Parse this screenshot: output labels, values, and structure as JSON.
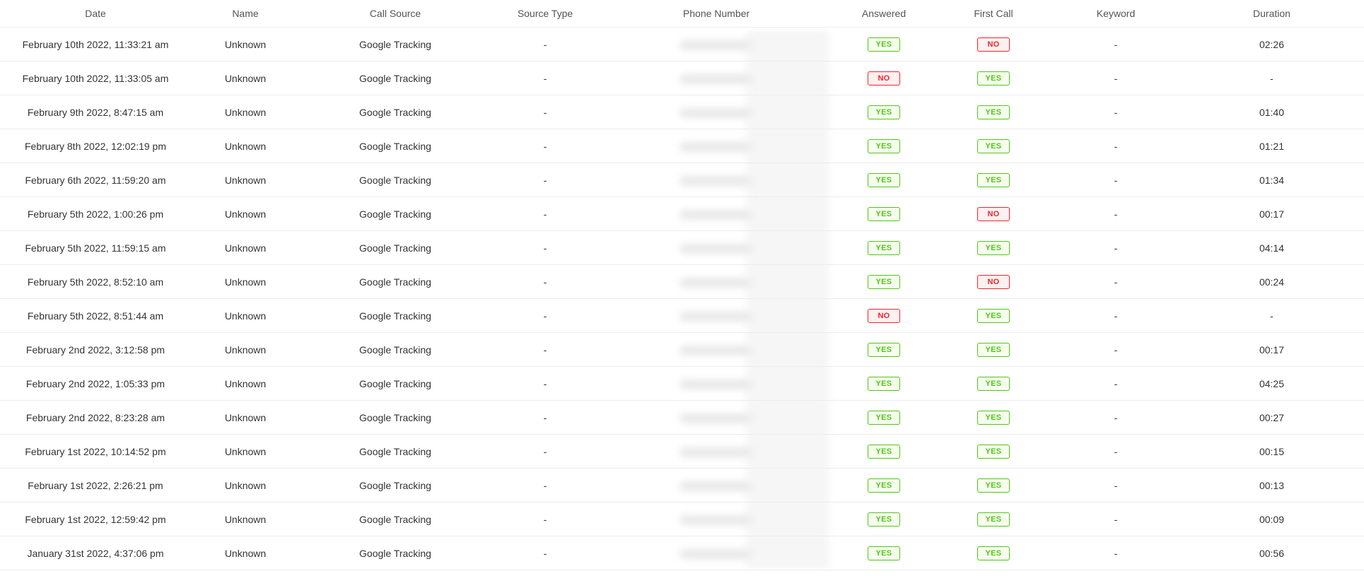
{
  "columns": {
    "date": "Date",
    "name": "Name",
    "call_source": "Call Source",
    "source_type": "Source Type",
    "phone_number": "Phone Number",
    "answered": "Answered",
    "first_call": "First Call",
    "keyword": "Keyword",
    "duration": "Duration"
  },
  "badge_colors": {
    "yes": "#52c41a",
    "no": "#f5222d"
  },
  "rows": [
    {
      "date": "February 10th 2022, 11:33:21 am",
      "name": "Unknown",
      "call_source": "Google Tracking",
      "source_type": "-",
      "answered": "YES",
      "first_call": "NO",
      "keyword": "-",
      "duration": "02:26"
    },
    {
      "date": "February 10th 2022, 11:33:05 am",
      "name": "Unknown",
      "call_source": "Google Tracking",
      "source_type": "-",
      "answered": "NO",
      "first_call": "YES",
      "keyword": "-",
      "duration": "-"
    },
    {
      "date": "February 9th 2022, 8:47:15 am",
      "name": "Unknown",
      "call_source": "Google Tracking",
      "source_type": "-",
      "answered": "YES",
      "first_call": "YES",
      "keyword": "-",
      "duration": "01:40"
    },
    {
      "date": "February 8th 2022, 12:02:19 pm",
      "name": "Unknown",
      "call_source": "Google Tracking",
      "source_type": "-",
      "answered": "YES",
      "first_call": "YES",
      "keyword": "-",
      "duration": "01:21"
    },
    {
      "date": "February 6th 2022, 11:59:20 am",
      "name": "Unknown",
      "call_source": "Google Tracking",
      "source_type": "-",
      "answered": "YES",
      "first_call": "YES",
      "keyword": "-",
      "duration": "01:34"
    },
    {
      "date": "February 5th 2022, 1:00:26 pm",
      "name": "Unknown",
      "call_source": "Google Tracking",
      "source_type": "-",
      "answered": "YES",
      "first_call": "NO",
      "keyword": "-",
      "duration": "00:17"
    },
    {
      "date": "February 5th 2022, 11:59:15 am",
      "name": "Unknown",
      "call_source": "Google Tracking",
      "source_type": "-",
      "answered": "YES",
      "first_call": "YES",
      "keyword": "-",
      "duration": "04:14"
    },
    {
      "date": "February 5th 2022, 8:52:10 am",
      "name": "Unknown",
      "call_source": "Google Tracking",
      "source_type": "-",
      "answered": "YES",
      "first_call": "NO",
      "keyword": "-",
      "duration": "00:24"
    },
    {
      "date": "February 5th 2022, 8:51:44 am",
      "name": "Unknown",
      "call_source": "Google Tracking",
      "source_type": "-",
      "answered": "NO",
      "first_call": "YES",
      "keyword": "-",
      "duration": "-"
    },
    {
      "date": "February 2nd 2022, 3:12:58 pm",
      "name": "Unknown",
      "call_source": "Google Tracking",
      "source_type": "-",
      "answered": "YES",
      "first_call": "YES",
      "keyword": "-",
      "duration": "00:17"
    },
    {
      "date": "February 2nd 2022, 1:05:33 pm",
      "name": "Unknown",
      "call_source": "Google Tracking",
      "source_type": "-",
      "answered": "YES",
      "first_call": "YES",
      "keyword": "-",
      "duration": "04:25"
    },
    {
      "date": "February 2nd 2022, 8:23:28 am",
      "name": "Unknown",
      "call_source": "Google Tracking",
      "source_type": "-",
      "answered": "YES",
      "first_call": "YES",
      "keyword": "-",
      "duration": "00:27"
    },
    {
      "date": "February 1st 2022, 10:14:52 pm",
      "name": "Unknown",
      "call_source": "Google Tracking",
      "source_type": "-",
      "answered": "YES",
      "first_call": "YES",
      "keyword": "-",
      "duration": "00:15"
    },
    {
      "date": "February 1st 2022, 2:26:21 pm",
      "name": "Unknown",
      "call_source": "Google Tracking",
      "source_type": "-",
      "answered": "YES",
      "first_call": "YES",
      "keyword": "-",
      "duration": "00:13"
    },
    {
      "date": "February 1st 2022, 12:59:42 pm",
      "name": "Unknown",
      "call_source": "Google Tracking",
      "source_type": "-",
      "answered": "YES",
      "first_call": "YES",
      "keyword": "-",
      "duration": "00:09"
    },
    {
      "date": "January 31st 2022, 4:37:06 pm",
      "name": "Unknown",
      "call_source": "Google Tracking",
      "source_type": "-",
      "answered": "YES",
      "first_call": "YES",
      "keyword": "-",
      "duration": "00:56"
    }
  ]
}
